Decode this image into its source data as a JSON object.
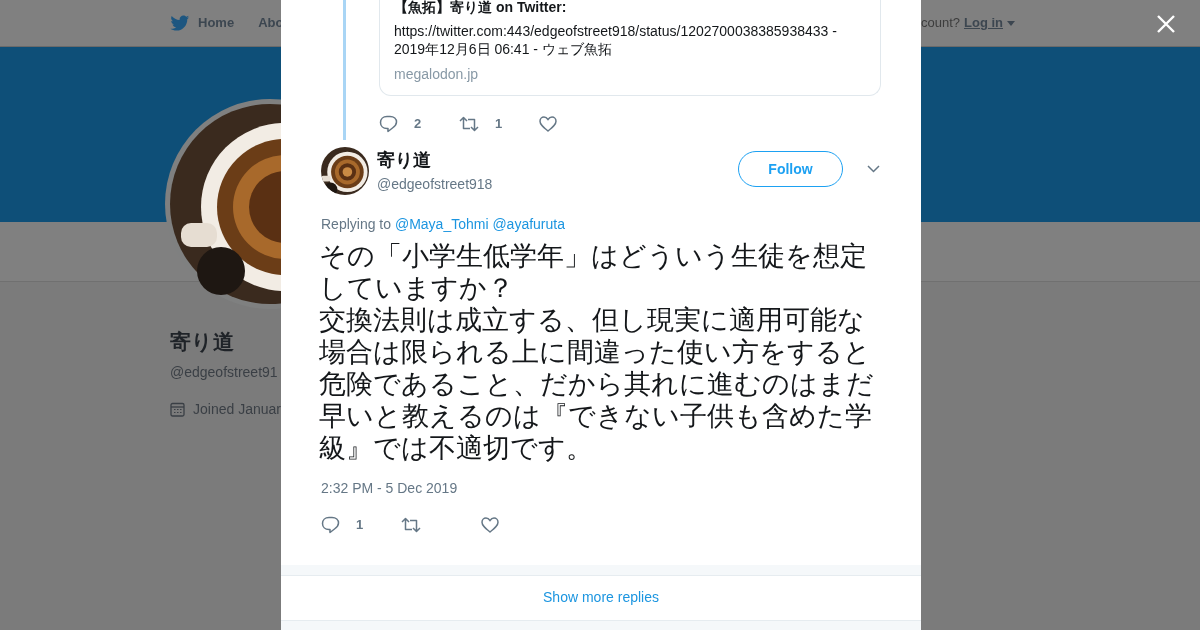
{
  "background_page": {
    "nav": {
      "items": [
        {
          "label": "Home",
          "kind": "home"
        },
        {
          "label": "Abo",
          "kind": "link"
        }
      ],
      "account_prompt": "count?",
      "login": "Log in"
    },
    "profile": {
      "name": "寄り道",
      "handle": "@edgeofstreet91",
      "joined": "Joined Januar"
    }
  },
  "modal": {
    "quoted_card": {
      "title": "【魚拓】寄り道 on Twitter:",
      "description": "https://twitter.com:443/edgeofstreet918/status/1202700038385938433 - 2019年12月6日 06:41 - ウェブ魚拓",
      "domain": "megalodon.jp"
    },
    "parent_actions": [
      {
        "kind": "reply",
        "count": "2"
      },
      {
        "kind": "retweet",
        "count": "1"
      },
      {
        "kind": "like"
      }
    ],
    "tweet": {
      "name": "寄り道",
      "handle": "@edgeofstreet918",
      "follow": "Follow",
      "replying_label": "Replying to",
      "mentions": [
        "@Maya_Tohmi",
        "@ayafuruta"
      ],
      "paragraphs": [
        "その「小学生低学年」はどういう生徒を想定していますか？",
        "交換法則は成立する、但し現実に適用可能な場合は限られる上に間違った使い方をすると危険であること、だから其れに進むのはまだ早いと教えるのは『できない子供も含めた学級』では不適切です。"
      ],
      "time": "2:32 PM - 5 Dec 2019",
      "actions": [
        {
          "kind": "reply",
          "count": "1"
        },
        {
          "kind": "retweet"
        },
        {
          "kind": "like"
        }
      ]
    },
    "show_more": "Show more replies"
  }
}
